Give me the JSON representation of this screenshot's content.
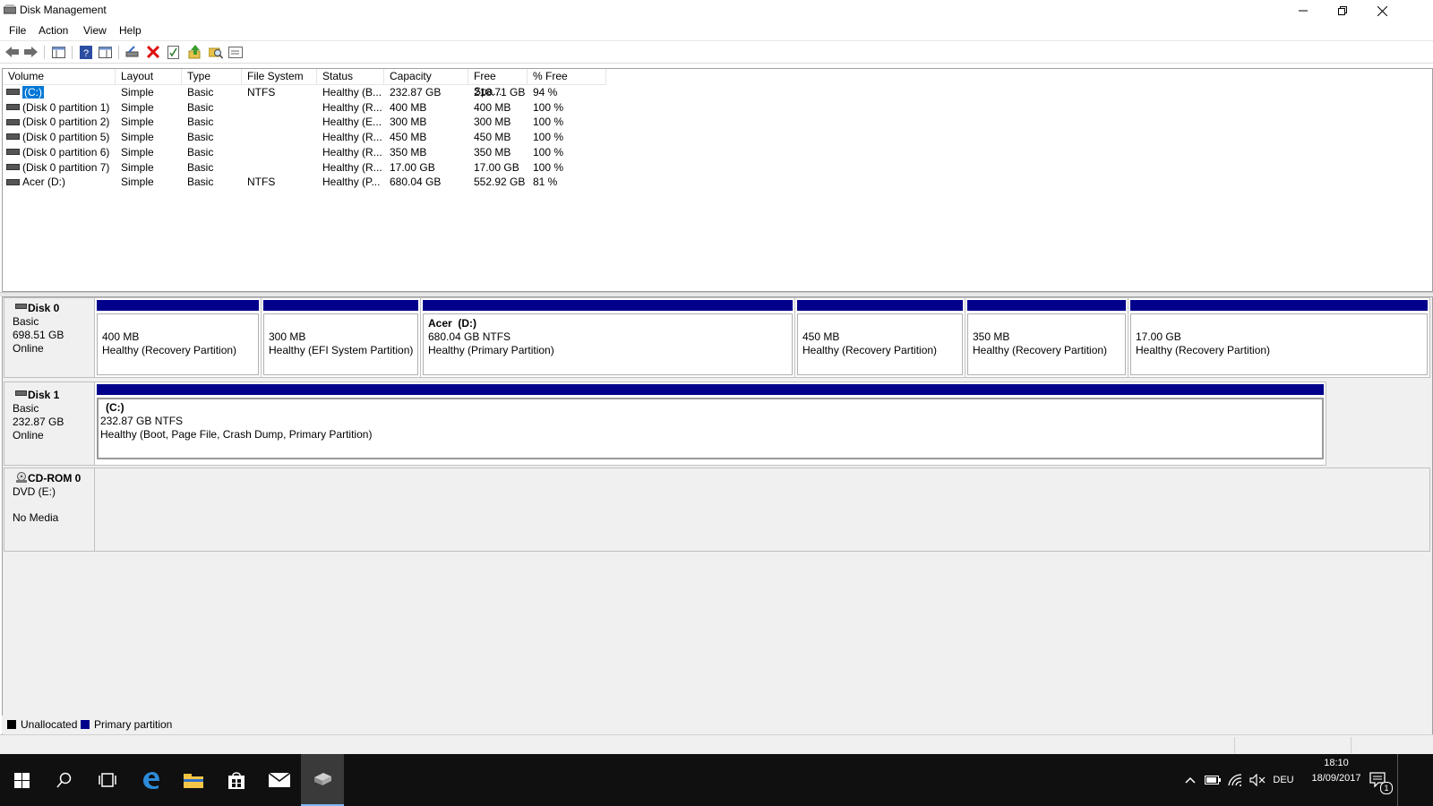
{
  "window": {
    "title": "Disk Management"
  },
  "menu": [
    "File",
    "Action",
    "View",
    "Help"
  ],
  "volume_table": {
    "headers": [
      "Volume",
      "Layout",
      "Type",
      "File System",
      "Status",
      "Capacity",
      "Free Spa...",
      "% Free"
    ],
    "rows": [
      [
        "(C:)",
        "Simple",
        "Basic",
        "NTFS",
        "Healthy (B...",
        "232.87 GB",
        "218.71 GB",
        "94 %"
      ],
      [
        "(Disk 0 partition 1)",
        "Simple",
        "Basic",
        "",
        "Healthy (R...",
        "400 MB",
        "400 MB",
        "100 %"
      ],
      [
        "(Disk 0 partition 2)",
        "Simple",
        "Basic",
        "",
        "Healthy (E...",
        "300 MB",
        "300 MB",
        "100 %"
      ],
      [
        "(Disk 0 partition 5)",
        "Simple",
        "Basic",
        "",
        "Healthy (R...",
        "450 MB",
        "450 MB",
        "100 %"
      ],
      [
        "(Disk 0 partition 6)",
        "Simple",
        "Basic",
        "",
        "Healthy (R...",
        "350 MB",
        "350 MB",
        "100 %"
      ],
      [
        "(Disk 0 partition 7)",
        "Simple",
        "Basic",
        "",
        "Healthy (R...",
        "17.00 GB",
        "17.00 GB",
        "100 %"
      ],
      [
        "Acer (D:)",
        "Simple",
        "Basic",
        "NTFS",
        "Healthy (P...",
        "680.04 GB",
        "552.92 GB",
        "81 %"
      ]
    ]
  },
  "disks": [
    {
      "name": "Disk 0",
      "type": "Basic",
      "size": "698.51 GB",
      "state": "Online",
      "partitions": [
        {
          "name": "",
          "size": "400 MB",
          "status": "Healthy (Recovery Partition)"
        },
        {
          "name": "",
          "size": "300 MB",
          "status": "Healthy (EFI System Partition)"
        },
        {
          "name": "Acer  (D:)",
          "size": "680.04 GB NTFS",
          "status": "Healthy (Primary Partition)"
        },
        {
          "name": "",
          "size": "450 MB",
          "status": "Healthy (Recovery Partition)"
        },
        {
          "name": "",
          "size": "350 MB",
          "status": "Healthy (Recovery Partition)"
        },
        {
          "name": "",
          "size": "17.00 GB",
          "status": "Healthy (Recovery Partition)"
        }
      ]
    },
    {
      "name": "Disk 1",
      "type": "Basic",
      "size": "232.87 GB",
      "state": "Online",
      "partitions": [
        {
          "name": "(C:)",
          "size": "232.87 GB NTFS",
          "status": "Healthy (Boot, Page File, Crash Dump, Primary Partition)"
        }
      ]
    }
  ],
  "cdrom": {
    "name": "CD-ROM 0",
    "drive": "DVD (E:)",
    "media": "No Media"
  },
  "legend": [
    {
      "label": "Unallocated",
      "color": "#000000"
    },
    {
      "label": "Primary partition",
      "color": "#00008b"
    }
  ],
  "taskbar": {
    "language": "DEU",
    "time": "18:10",
    "date": "18/09/2017",
    "notification_count": "1"
  },
  "colors": {
    "primary_partition": "#00008b",
    "selection": "#0078d7",
    "taskbar": "#101010"
  }
}
